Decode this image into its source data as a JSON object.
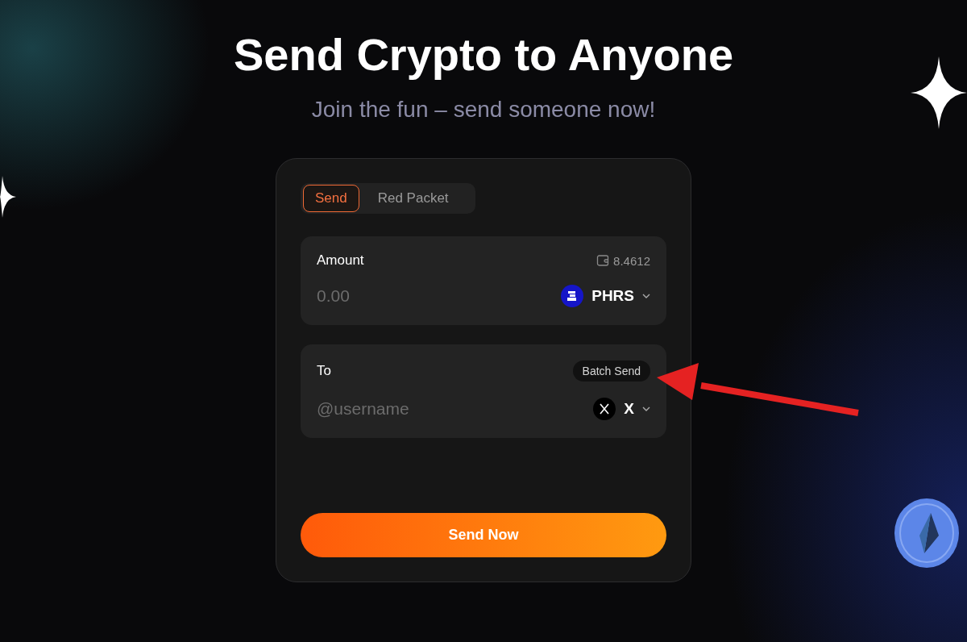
{
  "title": "Send Crypto to Anyone",
  "subtitle": "Join the fun – send someone now!",
  "tabs": [
    {
      "label": "Send",
      "selected": true
    },
    {
      "label": "Red Packet",
      "selected": false
    }
  ],
  "amount": {
    "label": "Amount",
    "balance": "8.4612",
    "placeholder": "0.00",
    "token": "PHRS"
  },
  "recipient": {
    "label": "To",
    "batch_button": "Batch Send",
    "placeholder": "@username",
    "platform": "X"
  },
  "submit_button": "Send Now"
}
